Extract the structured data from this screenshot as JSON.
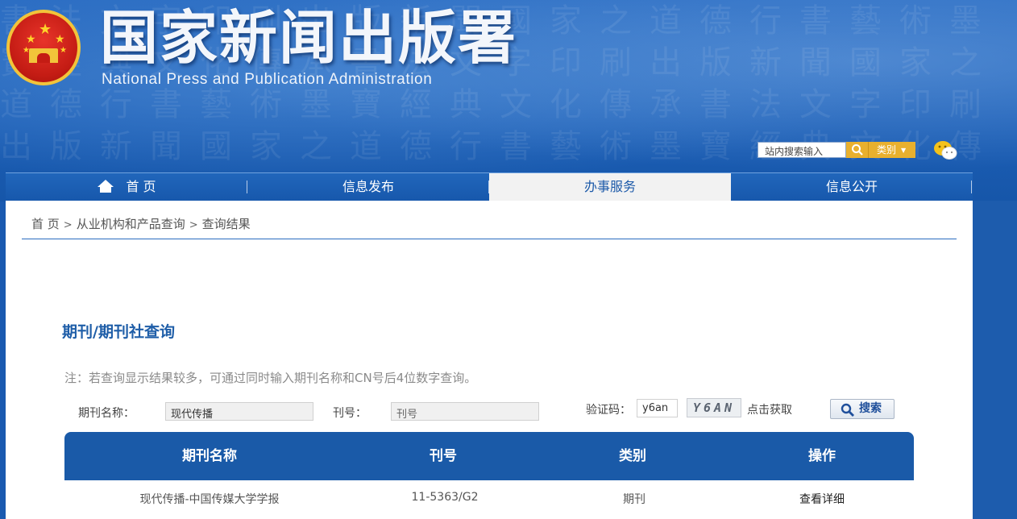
{
  "header": {
    "title": "国家新闻出版署",
    "subtitle": "National  Press and Publication Administration",
    "search_placeholder": "站内搜索输入",
    "category_label": "类别"
  },
  "nav": {
    "items": [
      {
        "label": "首 页"
      },
      {
        "label": "信息发布"
      },
      {
        "label": "办事服务"
      },
      {
        "label": "信息公开"
      }
    ],
    "active_index": 2
  },
  "breadcrumb": {
    "items": [
      "首 页",
      "从业机构和产品查询",
      "查询结果"
    ],
    "separator": ">"
  },
  "query": {
    "section_title": "期刊/期刊社查询",
    "note": "注：若查询显示结果较多，可通过同时输入期刊名称和CN号后4位数字查询。",
    "name_label": "期刊名称：",
    "name_value": "现代传播",
    "issn_label": "刊号：",
    "issn_placeholder": "刊号",
    "captcha_label": "验证码：",
    "captcha_value": "y6an",
    "captcha_image_text": "Y6AN",
    "captcha_refresh": "点击获取",
    "search_button": "搜索"
  },
  "table": {
    "headers": [
      "期刊名称",
      "刊号",
      "类别",
      "操作"
    ],
    "rows": [
      {
        "name": "现代传播-中国传媒大学学报",
        "issn": "11-5363/G2",
        "type": "期刊",
        "action": "查看详细"
      }
    ]
  },
  "colors": {
    "brand_blue": "#1a5aa8",
    "accent_gold": "#e8b02e"
  }
}
